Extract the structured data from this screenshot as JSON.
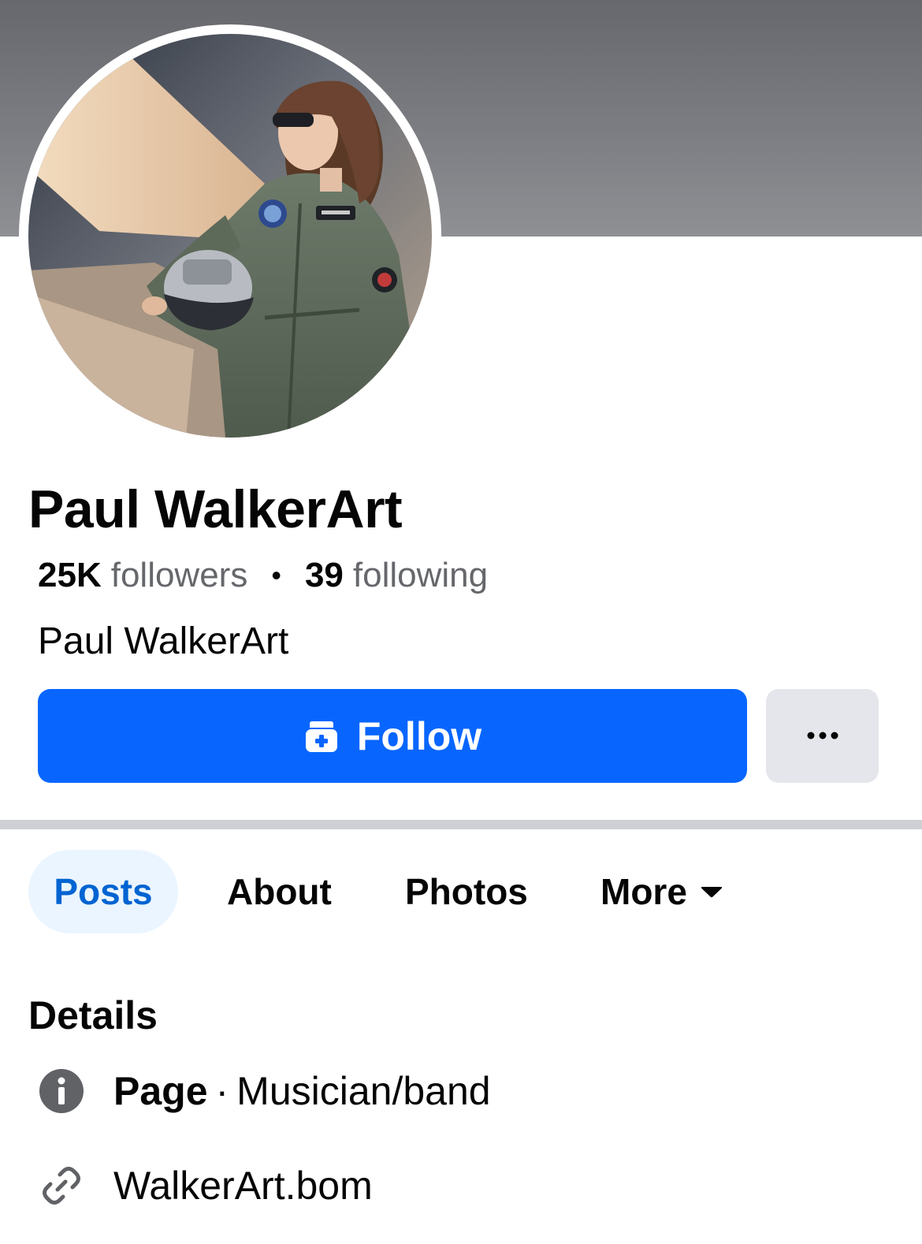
{
  "profile": {
    "name": "Paul WalkerArt",
    "followers_count": "25K",
    "followers_label": "followers",
    "following_count": "39",
    "following_label": "following",
    "separator": "•",
    "subtitle": "Paul WalkerArt"
  },
  "actions": {
    "follow_label": "Follow",
    "follow_icon": "follow-plus-icon",
    "more_icon": "more-dots-icon"
  },
  "tabs": [
    {
      "label": "Posts",
      "active": true
    },
    {
      "label": "About",
      "active": false
    },
    {
      "label": "Photos",
      "active": false
    },
    {
      "label": "More",
      "active": false
    }
  ],
  "details": {
    "title": "Details",
    "items": [
      {
        "icon": "info-icon",
        "bold": "Page",
        "separator": "·",
        "text": "Musician/band"
      },
      {
        "icon": "link-icon",
        "text": "WalkerArt.bom"
      }
    ]
  },
  "colors": {
    "accent": "#0866ff",
    "active_tab_bg": "#ebf5ff",
    "active_tab_text": "#0064d1",
    "secondary_text": "#65676b",
    "secondary_button": "#e4e6eb"
  }
}
